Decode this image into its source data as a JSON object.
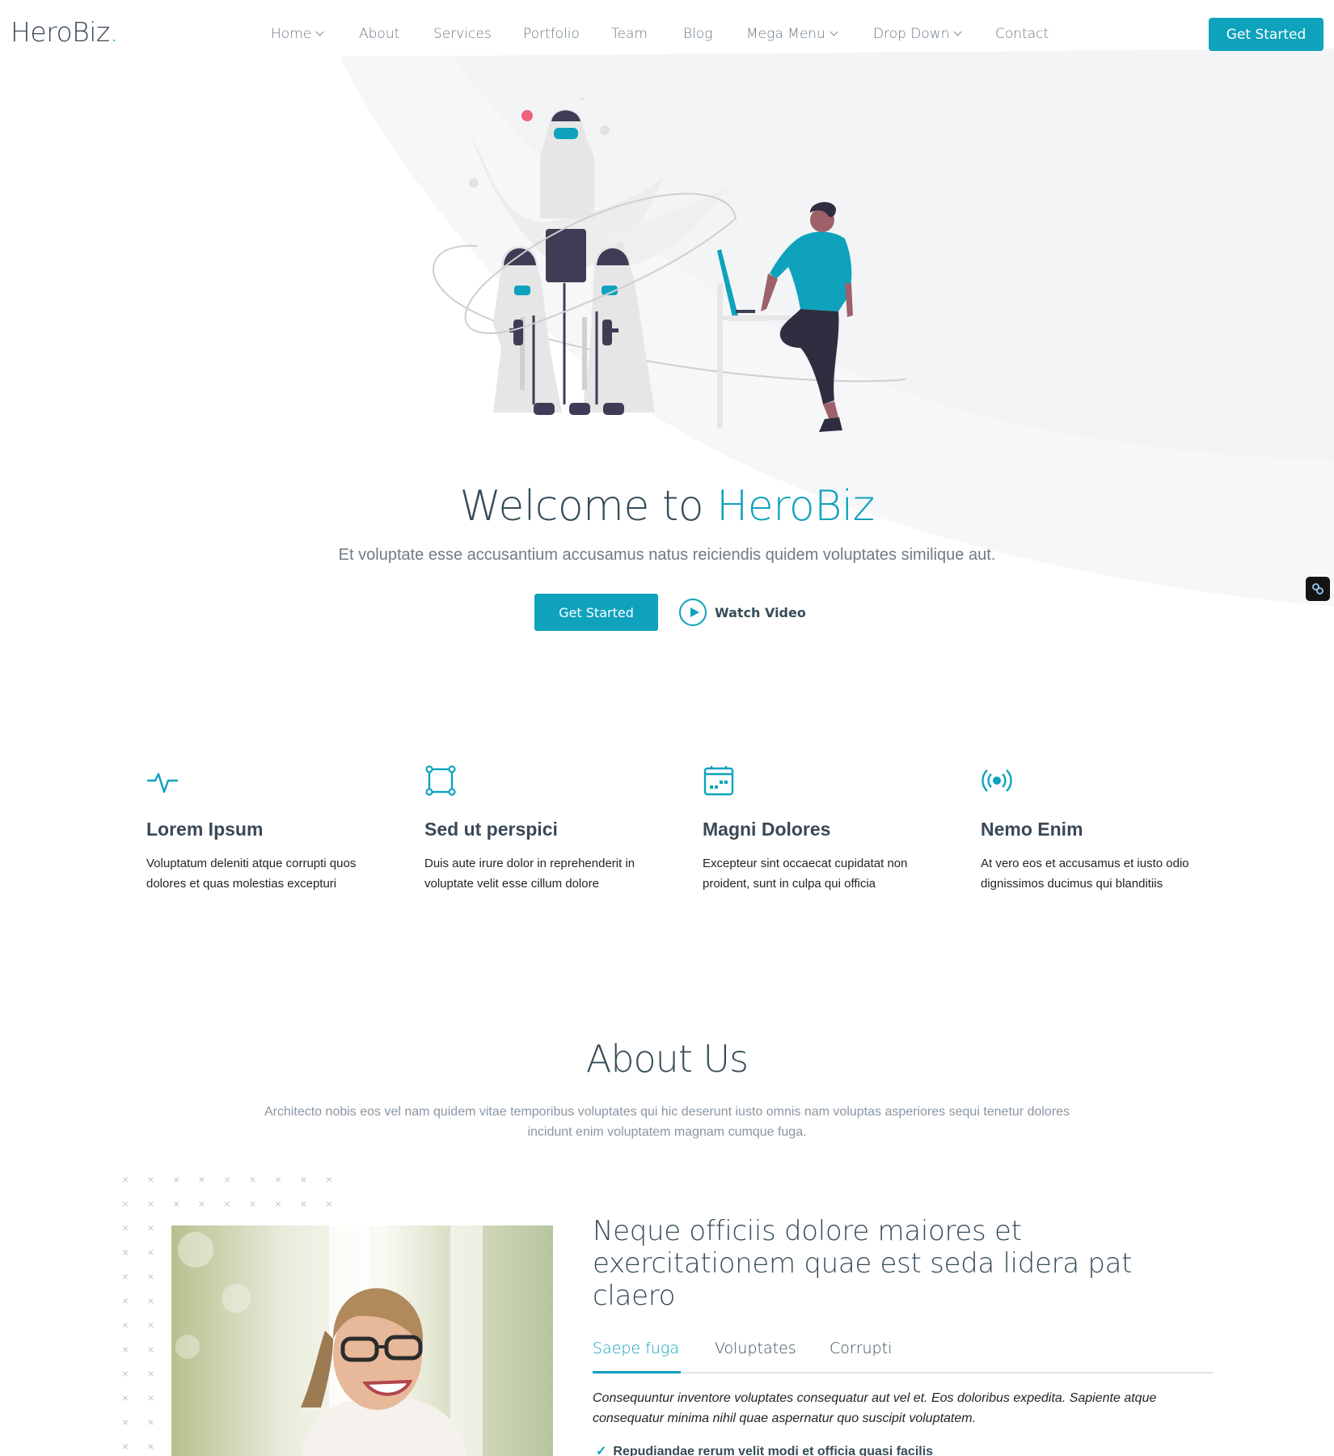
{
  "header": {
    "logo_text": "HeroBiz",
    "logo_dot": ".",
    "nav": [
      {
        "label": "Home",
        "dropdown": true
      },
      {
        "label": "About",
        "dropdown": false
      },
      {
        "label": "Services",
        "dropdown": false
      },
      {
        "label": "Portfolio",
        "dropdown": false
      },
      {
        "label": "Team",
        "dropdown": false
      },
      {
        "label": "Blog",
        "dropdown": false
      },
      {
        "label": "Mega Menu",
        "dropdown": true
      },
      {
        "label": "Drop Down",
        "dropdown": true
      },
      {
        "label": "Contact",
        "dropdown": false
      }
    ],
    "cta_label": "Get Started"
  },
  "hero": {
    "title_prefix": "Welcome to ",
    "title_accent": "HeroBiz",
    "subtitle": "Et voluptate esse accusantium accusamus natus reiciendis quidem voluptates similique aut.",
    "primary_button": "Get Started",
    "video_button": "Watch Video",
    "illustration": "rocket-launch-with-person-at-laptop"
  },
  "floating_widget": {
    "icon": "link-icon"
  },
  "features": [
    {
      "icon": "activity-icon",
      "title": "Lorem Ipsum",
      "description": "Voluptatum deleniti atque corrupti quos dolores et quas molestias excepturi"
    },
    {
      "icon": "bounding-box-icon",
      "title": "Sed ut perspici",
      "description": "Duis aute irure dolor in reprehenderit in voluptate velit esse cillum dolore"
    },
    {
      "icon": "calendar-icon",
      "title": "Magni Dolores",
      "description": "Excepteur sint occaecat cupidatat non proident, sunt in culpa qui officia"
    },
    {
      "icon": "broadcast-icon",
      "title": "Nemo Enim",
      "description": "At vero eos et accusamus et iusto odio dignissimos ducimus qui blanditiis"
    }
  ],
  "about": {
    "title": "About Us",
    "subtitle": "Architecto nobis eos vel nam quidem vitae temporibus voluptates qui hic deserunt iusto omnis nam voluptas asperiores sequi tenetur dolores incidunt enim voluptatem magnam cumque fuga.",
    "image": "smiling-woman-with-glasses",
    "heading": "Neque officiis dolore maiores et exercitationem quae est seda lidera pat claero",
    "tabs": [
      {
        "label": "Saepe fuga",
        "active": true
      },
      {
        "label": "Voluptates",
        "active": false
      },
      {
        "label": "Corrupti",
        "active": false
      }
    ],
    "tab_content": "Consequuntur inventore voluptates consequatur aut vel et. Eos doloribus expedita. Sapiente atque consequatur minima nihil quae aspernatur quo suscipit voluptatem.",
    "check_item": "Repudiandae rerum velit modi et officia quasi facilis"
  },
  "colors": {
    "accent": "#0ea2bd",
    "heading": "#364d59",
    "text": "#212529",
    "hero_bg": "#f8f9fa"
  }
}
